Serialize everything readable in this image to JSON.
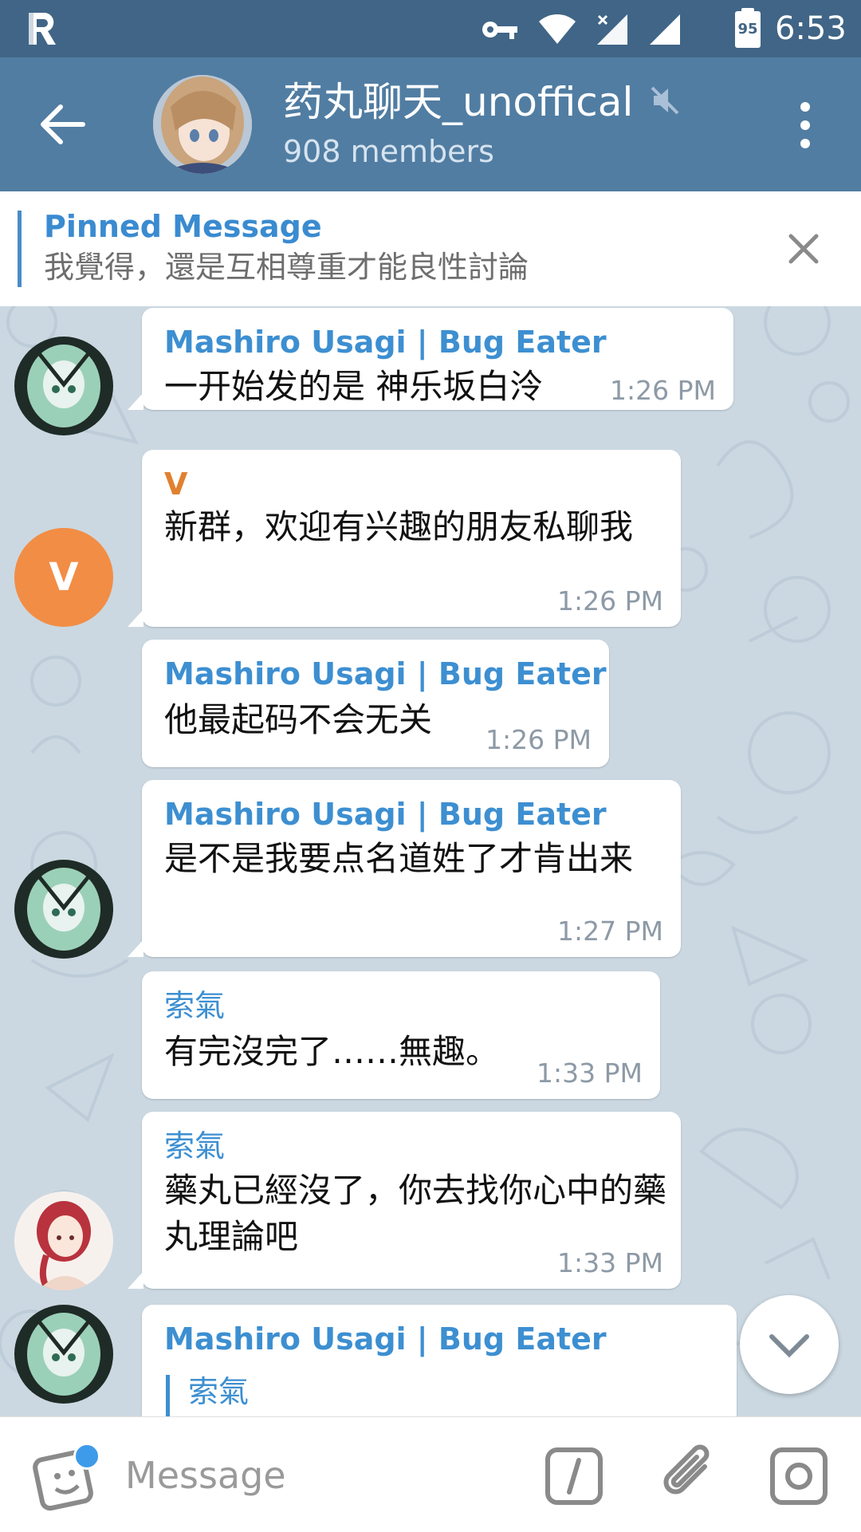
{
  "status_bar": {
    "battery": "95",
    "time": "6:53",
    "icons": [
      "app-logo-icon",
      "vpn-key-icon",
      "wifi-icon",
      "cell-signal-icon",
      "cell-signal-icon",
      "battery-icon"
    ]
  },
  "header": {
    "title": "药丸聊天_unoffical",
    "subtitle": "908 members",
    "icons": [
      "back-arrow-icon",
      "muted-icon",
      "more-vert-icon"
    ]
  },
  "pinned": {
    "title": "Pinned Message",
    "text": "我覺得，還是互相尊重才能良性討論"
  },
  "messages": [
    {
      "sender": "Mashiro Usagi | Bug Eater",
      "text": "一开始发的是 神乐坂白泠",
      "time": "1:26 PM"
    },
    {
      "sender": "V",
      "text": "新群，欢迎有兴趣的朋友私聊我",
      "time": "1:26 PM",
      "avatar_letter": "V",
      "avatar_color": "#f28d45",
      "sender_color": "#e0812f"
    },
    {
      "sender": "Mashiro Usagi | Bug Eater",
      "text": "他最起码不会无关",
      "time": "1:26 PM"
    },
    {
      "sender": "Mashiro Usagi | Bug Eater",
      "text": "是不是我要点名道姓了才肯出来",
      "time": "1:27 PM"
    },
    {
      "sender": "索氣",
      "text": "有完沒完了……無趣。",
      "time": "1:33 PM"
    },
    {
      "sender": "索氣",
      "text": "藥丸已經沒了，你去找你心中的藥丸理論吧",
      "time": "1:33 PM"
    },
    {
      "sender": "Mashiro Usagi | Bug Eater",
      "reply_to": "索氣"
    }
  ],
  "input": {
    "placeholder": "Message"
  },
  "colors": {
    "header": "#517da2",
    "status_bar": "#406586",
    "link_blue": "#3d8fd1",
    "wallpaper": "#cbd8e1"
  }
}
